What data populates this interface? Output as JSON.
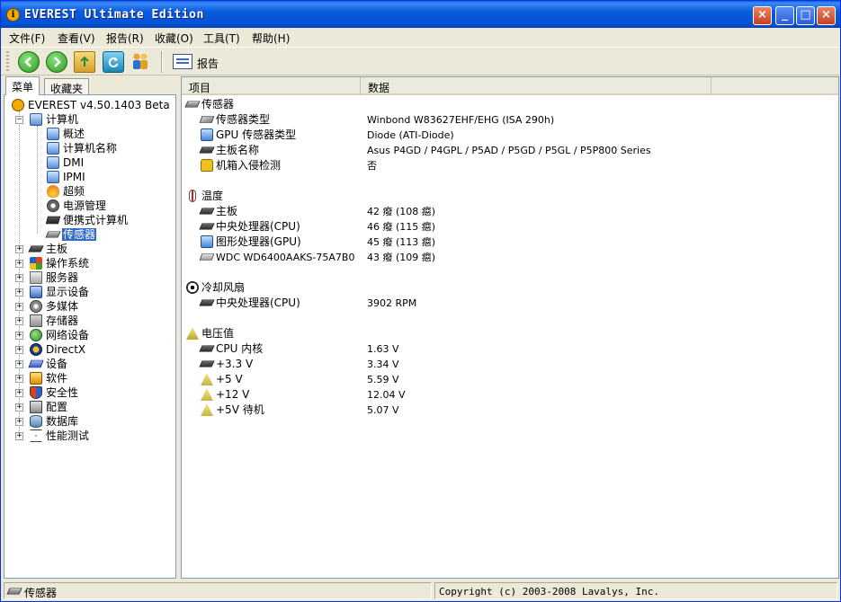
{
  "window": {
    "title": "EVEREST Ultimate Edition",
    "title_icon": "info-icon"
  },
  "menu": [
    {
      "label": "文件(F)"
    },
    {
      "label": "查看(V)"
    },
    {
      "label": "报告(R)"
    },
    {
      "label": "收藏(O)"
    },
    {
      "label": "工具(T)"
    },
    {
      "label": "帮助(H)"
    }
  ],
  "toolbar": {
    "report_label": "报告"
  },
  "left": {
    "tabs": [
      {
        "label": "菜单",
        "active": true
      },
      {
        "label": "收藏夹",
        "active": false
      }
    ],
    "tree": {
      "root": "EVEREST v4.50.1403 Beta",
      "computer": "计算机",
      "computer_children": [
        {
          "label": "概述",
          "icon": "computer-icon"
        },
        {
          "label": "计算机名称",
          "icon": "computer-icon"
        },
        {
          "label": "DMI",
          "icon": "computer-icon"
        },
        {
          "label": "IPMI",
          "icon": "computer-icon"
        },
        {
          "label": "超频",
          "icon": "fire-icon"
        },
        {
          "label": "电源管理",
          "icon": "power-icon"
        },
        {
          "label": "便携式计算机",
          "icon": "laptop-icon"
        },
        {
          "label": "传感器",
          "icon": "sensor-icon",
          "selected": true
        }
      ],
      "top_level": [
        {
          "label": "主板",
          "icon": "motherboard-icon"
        },
        {
          "label": "操作系统",
          "icon": "os-icon"
        },
        {
          "label": "服务器",
          "icon": "server-icon"
        },
        {
          "label": "显示设备",
          "icon": "display-icon"
        },
        {
          "label": "多媒体",
          "icon": "media-icon"
        },
        {
          "label": "存储器",
          "icon": "storage-icon"
        },
        {
          "label": "网络设备",
          "icon": "network-icon"
        },
        {
          "label": "DirectX",
          "icon": "directx-icon"
        },
        {
          "label": "设备",
          "icon": "device-icon"
        },
        {
          "label": "软件",
          "icon": "software-icon"
        },
        {
          "label": "安全性",
          "icon": "security-icon"
        },
        {
          "label": "配置",
          "icon": "config-icon"
        },
        {
          "label": "数据库",
          "icon": "database-icon"
        },
        {
          "label": "性能测试",
          "icon": "benchmark-icon"
        }
      ]
    }
  },
  "right": {
    "columns": [
      "项目",
      "数据"
    ],
    "sections": [
      {
        "title": "传感器",
        "icon": "sensor-icon",
        "rows": [
          {
            "key": "传感器类型",
            "value": "Winbond W83627EHF/EHG  (ISA 290h)",
            "icon": "chip-icon"
          },
          {
            "key": "GPU 传感器类型",
            "value": "Diode  (ATI-Diode)",
            "icon": "monitor-icon"
          },
          {
            "key": "主板名称",
            "value": "Asus P4GD / P4GPL / P5AD / P5GD / P5GL / P5P800 Series",
            "icon": "motherboard-icon"
          },
          {
            "key": "机箱入侵检测",
            "value": "否",
            "icon": "lock-icon"
          }
        ]
      },
      {
        "title": "温度",
        "icon": "thermometer-icon",
        "rows": [
          {
            "key": "主板",
            "value": "42 癈  (108 癋)",
            "icon": "motherboard-icon"
          },
          {
            "key": "中央处理器(CPU)",
            "value": "46 癈  (115 癋)",
            "icon": "cpu-icon"
          },
          {
            "key": "图形处理器(GPU)",
            "value": "45 癈  (113 癋)",
            "icon": "monitor-icon"
          },
          {
            "key": "WDC WD6400AAKS-75A7B0",
            "value": "43 癈  (109 癋)",
            "icon": "hdd-icon"
          }
        ]
      },
      {
        "title": "冷却风扇",
        "icon": "fan-icon",
        "rows": [
          {
            "key": "中央处理器(CPU)",
            "value": "3902 RPM",
            "icon": "cpu-icon"
          }
        ]
      },
      {
        "title": "电压值",
        "icon": "voltage-icon",
        "rows": [
          {
            "key": "CPU 内核",
            "value": "1.63 V",
            "icon": "cpu-icon"
          },
          {
            "key": "+3.3 V",
            "value": "3.34 V",
            "icon": "cpu-icon"
          },
          {
            "key": "+5 V",
            "value": "5.59 V",
            "icon": "voltage-icon"
          },
          {
            "key": "+12 V",
            "value": "12.04 V",
            "icon": "voltage-icon"
          },
          {
            "key": "+5V 待机",
            "value": "5.07 V",
            "icon": "voltage-icon"
          }
        ]
      }
    ]
  },
  "status": {
    "left": "传感器",
    "right": "Copyright (c) 2003-2008 Lavalys, Inc."
  }
}
